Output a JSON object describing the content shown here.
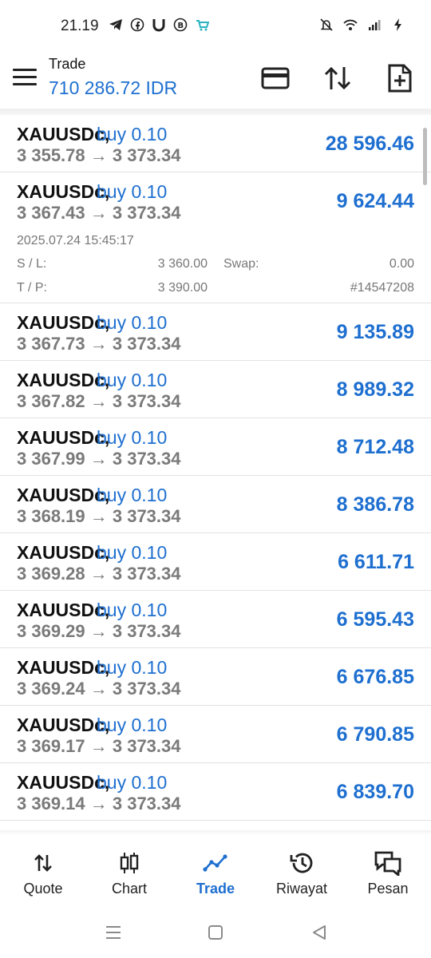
{
  "status_bar": {
    "time": "21.19",
    "left_icons": [
      "telegram-icon",
      "facebook-icon",
      "u-app-icon",
      "b-coin-icon",
      "shop-icon"
    ],
    "right_icons": [
      "mute-icon",
      "wifi-icon",
      "signal-icon",
      "charging-icon"
    ]
  },
  "header": {
    "title": "Trade",
    "balance": "710 286.72 IDR",
    "actions": [
      "card-icon",
      "sort-icon",
      "new-order-icon"
    ]
  },
  "colors": {
    "accent": "#1e6fd0",
    "muted": "#7a7a7a",
    "text": "#111111"
  },
  "trades": [
    {
      "symbol": "XAUUSDc,",
      "type": "buy 0.10",
      "prices": "3 355.78 → 3 373.34",
      "profit": "28 596.46"
    },
    {
      "symbol": "XAUUSDc,",
      "type": "buy 0.10",
      "prices": "3 367.43 → 3 373.34",
      "profit": "9 624.44",
      "details": {
        "datetime": "2025.07.24 15:45:17",
        "sl_label": "S / L:",
        "sl_value": "3 360.00",
        "swap_label": "Swap:",
        "swap_value": "0.00",
        "tp_label": "T / P:",
        "tp_value": "3 390.00",
        "ticket": "#14547208"
      }
    },
    {
      "symbol": "XAUUSDc,",
      "type": "buy 0.10",
      "prices": "3 367.73 → 3 373.34",
      "profit": "9 135.89"
    },
    {
      "symbol": "XAUUSDc,",
      "type": "buy 0.10",
      "prices": "3 367.82 → 3 373.34",
      "profit": "8 989.32"
    },
    {
      "symbol": "XAUUSDc,",
      "type": "buy 0.10",
      "prices": "3 367.99 → 3 373.34",
      "profit": "8 712.48"
    },
    {
      "symbol": "XAUUSDc,",
      "type": "buy 0.10",
      "prices": "3 368.19 → 3 373.34",
      "profit": "8 386.78"
    },
    {
      "symbol": "XAUUSDc,",
      "type": "buy 0.10",
      "prices": "3 369.28 → 3 373.34",
      "profit": "6 611.71"
    },
    {
      "symbol": "XAUUSDc,",
      "type": "buy 0.10",
      "prices": "3 369.29 → 3 373.34",
      "profit": "6 595.43"
    },
    {
      "symbol": "XAUUSDc,",
      "type": "buy 0.10",
      "prices": "3 369.24 → 3 373.34",
      "profit": "6 676.85"
    },
    {
      "symbol": "XAUUSDc,",
      "type": "buy 0.10",
      "prices": "3 369.17 → 3 373.34",
      "profit": "6 790.85"
    },
    {
      "symbol": "XAUUSDc,",
      "type": "buy 0.10",
      "prices": "3 369.14 → 3 373.34",
      "profit": "6 839.70"
    }
  ],
  "bottom_nav": [
    {
      "label": "Quote",
      "icon": "quote-icon",
      "active": false
    },
    {
      "label": "Chart",
      "icon": "chart-icon",
      "active": false
    },
    {
      "label": "Trade",
      "icon": "trade-icon",
      "active": true
    },
    {
      "label": "Riwayat",
      "icon": "history-icon",
      "active": false
    },
    {
      "label": "Pesan",
      "icon": "messages-icon",
      "active": false
    }
  ],
  "system_nav": [
    "recents-icon",
    "home-icon",
    "back-icon"
  ]
}
